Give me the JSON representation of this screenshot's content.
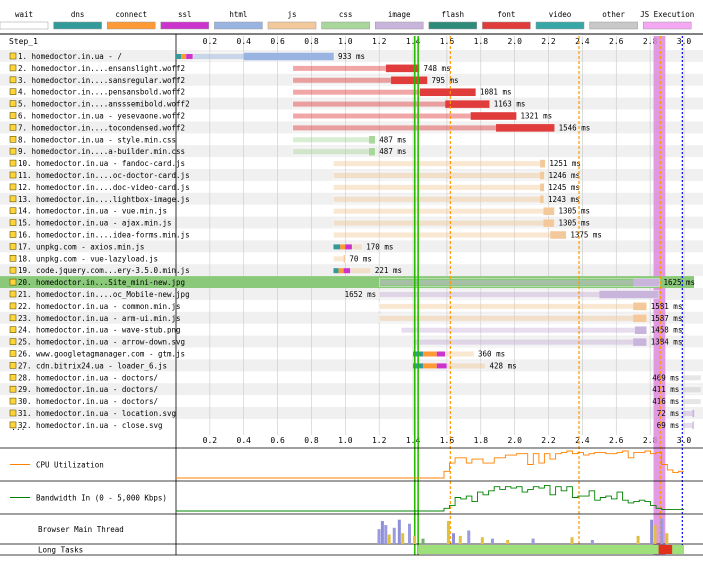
{
  "legend": [
    {
      "label": "wait",
      "color": "#ffffff"
    },
    {
      "label": "dns",
      "color": "#339999"
    },
    {
      "label": "connect",
      "color": "#ff9933"
    },
    {
      "label": "ssl",
      "color": "#cc33cc"
    },
    {
      "label": "html",
      "color": "#99b4e0"
    },
    {
      "label": "js",
      "color": "#f3c99b"
    },
    {
      "label": "css",
      "color": "#a8d69b"
    },
    {
      "label": "image",
      "color": "#c9b4dc"
    },
    {
      "label": "flash",
      "color": "#2e8b7a"
    },
    {
      "label": "font",
      "color": "#e03c3c"
    },
    {
      "label": "video",
      "color": "#36a6a6"
    },
    {
      "label": "other",
      "color": "#c8c8c8"
    },
    {
      "label": "JS Execution",
      "color": "#f4a8f4"
    }
  ],
  "step_label": "Step_1",
  "more_label": "...",
  "chart_data": {
    "type": "waterfall",
    "xlim": [
      0,
      3.0
    ],
    "x_unit": "seconds",
    "x_ticks": [
      "0.2",
      "0.4",
      "0.6",
      "0.8",
      "1.0",
      "1.2",
      "1.4",
      "1.6",
      "1.8",
      "2.0",
      "2.2",
      "2.4",
      "2.6",
      "2.8",
      "3.0"
    ],
    "markers": [
      {
        "type": "start_render",
        "x": 1.41,
        "color": "#28bc00"
      },
      {
        "type": "start_render_end",
        "x": 1.43,
        "color": "#28bc00"
      },
      {
        "type": "dom_content_loaded",
        "x": 1.62,
        "color": "#ff9900"
      },
      {
        "type": "first_interactive",
        "x": 2.38,
        "color": "#ff9900"
      },
      {
        "type": "load_event",
        "x": 2.86,
        "color": "#ff9900"
      },
      {
        "type": "document_complete",
        "x": 2.99,
        "color": "#0000ff"
      }
    ],
    "requests": [
      {
        "label": "1. homedoctor.in.ua - /",
        "type": "html",
        "start": 0.0,
        "dns": 0.03,
        "connect": 0.03,
        "ssl": 0.04,
        "ttfb": 0.3,
        "end": 0.933,
        "time_label": "933 ms",
        "highlight": false
      },
      {
        "label": "2. homedoctor.in....ensanslight.woff2",
        "type": "font",
        "start": 0.69,
        "dns": 0,
        "connect": 0,
        "ssl": 0,
        "ttfb": 0.55,
        "end": 1.438,
        "time_label": "748 ms",
        "highlight": false
      },
      {
        "label": "3. homedoctor.in....sansregular.woff2",
        "type": "font",
        "start": 0.69,
        "dns": 0,
        "connect": 0,
        "ssl": 0,
        "ttfb": 0.58,
        "end": 1.485,
        "time_label": "795 ms",
        "highlight": false
      },
      {
        "label": "4. homedoctor.in....pensansbold.woff2",
        "type": "font",
        "start": 0.69,
        "dns": 0,
        "connect": 0,
        "ssl": 0,
        "ttfb": 0.75,
        "end": 1.771,
        "time_label": "1081 ms",
        "highlight": false
      },
      {
        "label": "5. homedoctor.in....ansssemibold.woff2",
        "type": "font",
        "start": 0.69,
        "dns": 0,
        "connect": 0,
        "ssl": 0,
        "ttfb": 0.9,
        "end": 1.853,
        "time_label": "1163 ms",
        "highlight": false
      },
      {
        "label": "6. homedoctor.in.ua - yesevaone.woff2",
        "type": "font",
        "start": 0.69,
        "dns": 0,
        "connect": 0,
        "ssl": 0,
        "ttfb": 1.05,
        "end": 2.011,
        "time_label": "1321 ms",
        "highlight": false
      },
      {
        "label": "7. homedoctor.in....tocondensed.woff2",
        "type": "font",
        "start": 0.69,
        "dns": 0,
        "connect": 0,
        "ssl": 0,
        "ttfb": 1.2,
        "end": 2.236,
        "time_label": "1546 ms",
        "highlight": false
      },
      {
        "label": "8. homedoctor.in.ua - style.min.css",
        "type": "css",
        "start": 0.69,
        "dns": 0,
        "connect": 0,
        "ssl": 0,
        "ttfb": 0.45,
        "end": 1.177,
        "time_label": "487 ms",
        "highlight": false
      },
      {
        "label": "9. homedoctor.in....a-builder.min.css",
        "type": "css",
        "start": 0.69,
        "dns": 0,
        "connect": 0,
        "ssl": 0,
        "ttfb": 0.45,
        "end": 1.177,
        "time_label": "487 ms",
        "highlight": false
      },
      {
        "label": "10. homedoctor.in.ua - fandoc-card.js",
        "type": "js",
        "start": 0.93,
        "dns": 0,
        "connect": 0,
        "ssl": 0,
        "ttfb": 1.22,
        "end": 2.181,
        "time_label": "1251 ms",
        "highlight": false
      },
      {
        "label": "11. homedoctor.in....oc-doctor-card.js",
        "type": "js",
        "start": 0.93,
        "dns": 0,
        "connect": 0,
        "ssl": 0,
        "ttfb": 1.22,
        "end": 2.176,
        "time_label": "1246 ms",
        "highlight": false
      },
      {
        "label": "12. homedoctor.in....doc-video-card.js",
        "type": "js",
        "start": 0.93,
        "dns": 0,
        "connect": 0,
        "ssl": 0,
        "ttfb": 1.22,
        "end": 2.175,
        "time_label": "1245 ms",
        "highlight": false
      },
      {
        "label": "13. homedoctor.in....lightbox-image.js",
        "type": "js",
        "start": 0.93,
        "dns": 0,
        "connect": 0,
        "ssl": 0,
        "ttfb": 1.22,
        "end": 2.173,
        "time_label": "1243 ms",
        "highlight": false
      },
      {
        "label": "14. homedoctor.in.ua - vue.min.js",
        "type": "js",
        "start": 0.93,
        "dns": 0,
        "connect": 0,
        "ssl": 0,
        "ttfb": 1.24,
        "end": 2.235,
        "time_label": "1305 ms",
        "highlight": false
      },
      {
        "label": "15. homedoctor.in.ua - ajax.min.js",
        "type": "js",
        "start": 0.93,
        "dns": 0,
        "connect": 0,
        "ssl": 0,
        "ttfb": 1.24,
        "end": 2.235,
        "time_label": "1305 ms",
        "highlight": false
      },
      {
        "label": "16. homedoctor.in....idea-forms.min.js",
        "type": "js",
        "start": 0.93,
        "dns": 0,
        "connect": 0,
        "ssl": 0,
        "ttfb": 1.28,
        "end": 2.305,
        "time_label": "1375 ms",
        "highlight": false
      },
      {
        "label": "17. unpkg.com - axios.min.js",
        "type": "js",
        "start": 0.93,
        "dns": 0.04,
        "connect": 0.03,
        "ssl": 0.04,
        "ttfb": 0.15,
        "end": 1.1,
        "time_label": "170 ms",
        "highlight": false
      },
      {
        "label": "18. unpkg.com - vue-lazyload.js",
        "type": "js",
        "start": 0.93,
        "dns": 0,
        "connect": 0,
        "ssl": 0,
        "ttfb": 0.06,
        "end": 1.0,
        "time_label": "70 ms",
        "highlight": false
      },
      {
        "label": "19. code.jquery.com...ery-3.5.0.min.js",
        "type": "js",
        "start": 0.93,
        "dns": 0.03,
        "connect": 0.03,
        "ssl": 0.04,
        "ttfb": 0.19,
        "end": 1.151,
        "time_label": "221 ms",
        "highlight": false
      },
      {
        "label": "20. homedoctor.in...Site_mini-new.jpg",
        "type": "image",
        "start": 1.2,
        "dns": 0,
        "connect": 0,
        "ssl": 0,
        "ttfb": 1.5,
        "end": 2.855,
        "time_label": "1625 ms",
        "highlight": true
      },
      {
        "label": "21. homedoctor.in....oc_Mobile-new.jpg",
        "type": "image",
        "start": 1.2,
        "dns": 0,
        "connect": 0,
        "ssl": 0,
        "ttfb": 1.3,
        "end": 2.852,
        "time_label": "1652 ms",
        "label_left": true,
        "highlight": false
      },
      {
        "label": "22. homedoctor.in.ua - common.min.js",
        "type": "js",
        "start": 1.2,
        "dns": 0,
        "connect": 0,
        "ssl": 0,
        "ttfb": 1.5,
        "end": 2.78,
        "time_label": "1581 ms",
        "highlight": false
      },
      {
        "label": "23. homedoctor.in.ua - arm-ui.min.js",
        "type": "js",
        "start": 1.2,
        "dns": 0,
        "connect": 0,
        "ssl": 0,
        "ttfb": 1.5,
        "end": 2.78,
        "time_label": "1587 ms",
        "highlight": false
      },
      {
        "label": "24. homedoctor.in.ua - wave-stub.png",
        "type": "image",
        "start": 1.33,
        "dns": 0,
        "connect": 0,
        "ssl": 0,
        "ttfb": 1.38,
        "end": 2.78,
        "time_label": "1458 ms",
        "highlight": false
      },
      {
        "label": "25. homedoctor.in.ua - arrow-down.svg",
        "type": "image",
        "start": 1.4,
        "dns": 0,
        "connect": 0,
        "ssl": 0,
        "ttfb": 1.3,
        "end": 2.78,
        "time_label": "1384 ms",
        "highlight": false
      },
      {
        "label": "26. www.googletagmanager.com - gtm.js",
        "type": "js",
        "start": 1.4,
        "dns": 0.06,
        "connect": 0.08,
        "ssl": 0.05,
        "ttfb": 0.3,
        "end": 1.76,
        "time_label": "360 ms",
        "highlight": false
      },
      {
        "label": "27. cdn.bitrix24.ua - loader_6.js",
        "type": "js",
        "start": 1.4,
        "dns": 0.06,
        "connect": 0.08,
        "ssl": 0.06,
        "ttfb": 0.36,
        "end": 1.828,
        "time_label": "428 ms",
        "highlight": false
      },
      {
        "label": "28. homedoctor.in.ua - doctors/",
        "type": "other",
        "start": 2.99,
        "dns": 0,
        "connect": 0,
        "ssl": 0,
        "ttfb": 0.4,
        "end": 3.459,
        "time_label": "469 ms",
        "label_left": true,
        "highlight": false
      },
      {
        "label": "29. homedoctor.in.ua - doctors/",
        "type": "other",
        "start": 2.99,
        "dns": 0,
        "connect": 0,
        "ssl": 0,
        "ttfb": 0.35,
        "end": 3.401,
        "time_label": "411 ms",
        "label_left": true,
        "highlight": false
      },
      {
        "label": "30. homedoctor.in.ua - doctors/",
        "type": "other",
        "start": 2.99,
        "dns": 0,
        "connect": 0,
        "ssl": 0,
        "ttfb": 0.35,
        "end": 3.406,
        "time_label": "416 ms",
        "label_left": true,
        "highlight": false
      },
      {
        "label": "31. homedoctor.in.ua - location.svg",
        "type": "image",
        "start": 2.99,
        "dns": 0,
        "connect": 0,
        "ssl": 0,
        "ttfb": 0.06,
        "end": 3.062,
        "time_label": "72 ms",
        "label_left": true,
        "highlight": false
      },
      {
        "label": "32. homedoctor.in.ua - close.svg",
        "type": "image",
        "start": 2.99,
        "dns": 0,
        "connect": 0,
        "ssl": 0,
        "ttfb": 0.06,
        "end": 3.059,
        "time_label": "69 ms",
        "label_left": true,
        "highlight": false
      }
    ],
    "js_execution_band": {
      "start": 2.82,
      "end": 2.89
    },
    "metrics": [
      {
        "label": "CPU Utilization",
        "color": "#ff8000",
        "values": [
          0,
          0,
          0,
          0,
          0,
          0,
          0,
          0,
          0,
          0,
          0,
          0,
          0,
          0,
          0,
          0,
          0,
          0,
          0,
          0,
          0,
          0,
          0,
          0,
          0,
          0,
          0,
          0,
          0,
          0,
          0,
          0,
          0,
          0,
          0,
          0,
          0,
          0,
          0,
          0,
          0,
          0,
          0,
          0,
          0,
          0,
          0,
          0,
          0.25,
          0.55,
          0.75,
          0.75,
          0.55,
          0.7,
          0.7,
          0.55,
          0.55,
          0.75,
          0.75,
          0.85,
          0.85,
          0.9,
          0.9,
          0.5,
          0.9,
          0.55,
          0.9,
          0.7,
          0.9,
          0.95,
          1.0,
          0.9,
          0.95,
          0.85,
          0.9,
          0.95,
          0.95,
          0.9,
          0.9,
          0.95,
          1.0,
          0.75,
          0.95,
          0.95,
          1.0,
          0.9,
          0.95,
          0.5,
          0.3,
          0.2,
          0.25
        ]
      },
      {
        "label": "Bandwidth In (0 - 5,000 Kbps)",
        "color": "#008000",
        "values": [
          0,
          0,
          0,
          0,
          0,
          0,
          0,
          0,
          0,
          0,
          0,
          0,
          0,
          0,
          0,
          0,
          0,
          0,
          0,
          0,
          0,
          0,
          0,
          0,
          0,
          0,
          0,
          0,
          0,
          0,
          0,
          0,
          0,
          0,
          0,
          0,
          0,
          0,
          0,
          0,
          0,
          0,
          0,
          0,
          0,
          0,
          0,
          0,
          0.1,
          0.2,
          0.5,
          0.45,
          0.55,
          0.35,
          0.7,
          0.6,
          0.75,
          0.9,
          0.8,
          0.9,
          0.85,
          0.9,
          0.7,
          0.8,
          0.9,
          0.85,
          0.95,
          0.6,
          0.9,
          0.75,
          0.9,
          0.5,
          0.55,
          0.55,
          0.75,
          0.4,
          0.5,
          0.55,
          0.45,
          0.7,
          0.4,
          0.3,
          0.35,
          0.4,
          0.35,
          0.2,
          0.1,
          0.05,
          0.05,
          0.05,
          0.05
        ]
      },
      {
        "label": "Browser Main Thread",
        "color": "#000000"
      },
      {
        "label": "Long Tasks",
        "color": "#000000"
      }
    ],
    "main_thread_spikes": [
      {
        "x": 1.19,
        "h": 0.55,
        "c": "#9a9ae0"
      },
      {
        "x": 1.21,
        "h": 0.85,
        "c": "#8f8fd8"
      },
      {
        "x": 1.23,
        "h": 0.7,
        "c": "#9a9ae0"
      },
      {
        "x": 1.25,
        "h": 0.35,
        "c": "#e0c040"
      },
      {
        "x": 1.28,
        "h": 0.6,
        "c": "#9a9ae0"
      },
      {
        "x": 1.31,
        "h": 0.9,
        "c": "#8f8fd8"
      },
      {
        "x": 1.33,
        "h": 0.4,
        "c": "#e0c040"
      },
      {
        "x": 1.37,
        "h": 0.75,
        "c": "#9a9ae0"
      },
      {
        "x": 1.4,
        "h": 0.3,
        "c": "#e0c040"
      },
      {
        "x": 1.45,
        "h": 0.2,
        "c": "#70b070"
      },
      {
        "x": 1.6,
        "h": 0.85,
        "c": "#e0c040"
      },
      {
        "x": 1.63,
        "h": 0.4,
        "c": "#8f8fd8"
      },
      {
        "x": 1.67,
        "h": 0.3,
        "c": "#e0c040"
      },
      {
        "x": 1.72,
        "h": 0.5,
        "c": "#9a9ae0"
      },
      {
        "x": 1.8,
        "h": 0.25,
        "c": "#e0c040"
      },
      {
        "x": 1.86,
        "h": 0.2,
        "c": "#9a9ae0"
      },
      {
        "x": 1.95,
        "h": 0.15,
        "c": "#e0c040"
      },
      {
        "x": 2.1,
        "h": 0.2,
        "c": "#9a9ae0"
      },
      {
        "x": 2.33,
        "h": 0.25,
        "c": "#e0c040"
      },
      {
        "x": 2.45,
        "h": 0.15,
        "c": "#9a9ae0"
      },
      {
        "x": 2.72,
        "h": 0.3,
        "c": "#e0c040"
      },
      {
        "x": 2.8,
        "h": 0.9,
        "c": "#8f8fd8"
      },
      {
        "x": 2.82,
        "h": 0.7,
        "c": "#e0c040"
      },
      {
        "x": 2.86,
        "h": 0.95,
        "c": "#9a9ae0"
      },
      {
        "x": 2.89,
        "h": 0.4,
        "c": "#e0c040"
      }
    ],
    "long_tasks": [
      {
        "start": 1.43,
        "end": 3.0,
        "color": "#9ee07a"
      },
      {
        "start": 2.85,
        "end": 2.93,
        "color": "#e0301e"
      }
    ]
  }
}
